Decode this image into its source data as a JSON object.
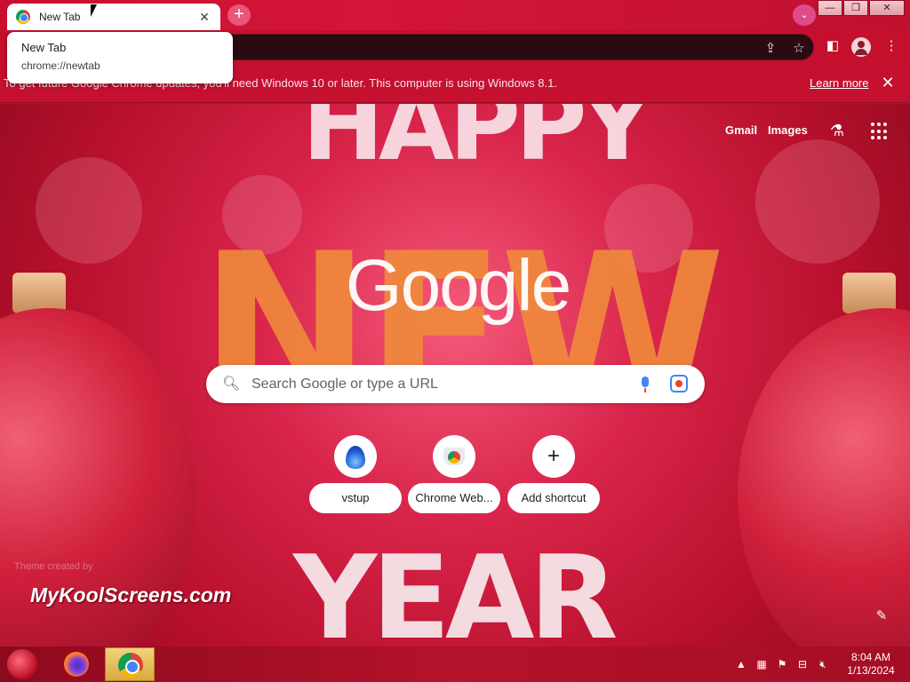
{
  "tab": {
    "title": "New Tab",
    "close_glyph": "✕"
  },
  "tooltip": {
    "title": "New Tab",
    "url": "chrome://newtab"
  },
  "window_controls": {
    "minimize": "—",
    "maximize": "❐",
    "close": "✕"
  },
  "infobar": {
    "message": "To get future Google Chrome updates, you'll need Windows 10 or later. This computer is using Windows 8.1.",
    "learn_more": "Learn more",
    "close_glyph": "✕"
  },
  "ntp": {
    "links": {
      "gmail": "Gmail",
      "images": "Images"
    },
    "logo": "Google",
    "search_placeholder": "Search Google or type a URL",
    "shortcuts": [
      {
        "label": "vstup",
        "icon": "flame-icon"
      },
      {
        "label": "Chrome Web...",
        "icon": "chrome-web-store-icon"
      },
      {
        "label": "Add shortcut",
        "icon": "plus-icon"
      }
    ],
    "theme_credit": "Theme created by",
    "decor": {
      "top_word": "HAPPY",
      "middle_word": "NEW",
      "bottom_word": "YEAR"
    }
  },
  "watermark": "MyKoolScreens.com",
  "taskbar": {
    "clock_time": "8:04 AM",
    "clock_date": "1/13/2024"
  },
  "colors": {
    "theme_red": "#c4102d",
    "omnibox_dark": "#2a0b12",
    "accent_pink": "#e8567a"
  }
}
